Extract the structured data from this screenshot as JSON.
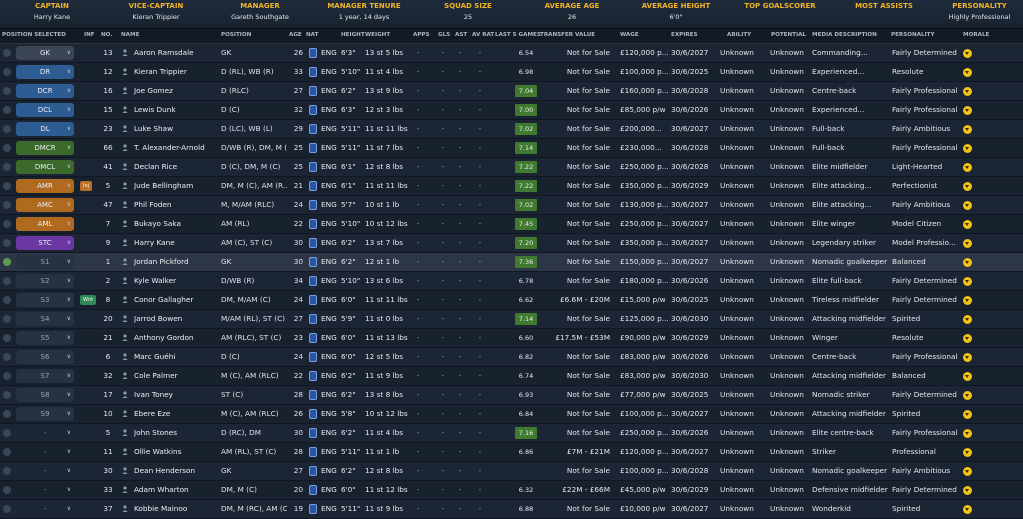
{
  "summary": [
    {
      "key": "captain",
      "label": "CAPTAIN",
      "value": "Harry Kane"
    },
    {
      "key": "vice_captain",
      "label": "VICE-CAPTAIN",
      "value": "Kieran Trippier"
    },
    {
      "key": "manager",
      "label": "MANAGER",
      "value": "Gareth Southgate"
    },
    {
      "key": "manager_tenure",
      "label": "MANAGER TENURE",
      "value": "1 year, 14 days"
    },
    {
      "key": "squad_size",
      "label": "SQUAD SIZE",
      "value": "25"
    },
    {
      "key": "average_age",
      "label": "AVERAGE AGE",
      "value": "26"
    },
    {
      "key": "average_height",
      "label": "AVERAGE HEIGHT",
      "value": "6'0\""
    },
    {
      "key": "top_goalscorer",
      "label": "TOP GOALSCORER",
      "value": ""
    },
    {
      "key": "most_assists",
      "label": "MOST ASSISTS",
      "value": ""
    },
    {
      "key": "personality",
      "label": "PERSONALITY",
      "value": "Highly Professional"
    }
  ],
  "columns": {
    "position_selected": "POSITION SELECTED",
    "inf": "INF",
    "no": "NO.",
    "name": "NAME",
    "position": "POSITION",
    "age": "AGE",
    "nat": "NAT",
    "height": "HEIGHT",
    "weight": "WEIGHT",
    "apps": "APPS",
    "gls": "GLS",
    "ast": "AST",
    "av_rat": "AV RAT",
    "last5": "LAST 5 GAMES",
    "transfer_value": "TRANSFER VALUE",
    "wage": "WAGE",
    "expires": "EXPIRES",
    "ability": "ABILITY",
    "potential": "POTENTIAL",
    "media": "MEDIA DESCRIPTION",
    "personality": "PERSONALITY",
    "morale": "MORALE"
  },
  "colors": {
    "header_accent": "#f0b429",
    "pos_def": "#2c5c92",
    "pos_mid": "#3c6a2a",
    "pos_amid": "#b06a1f",
    "pos_st": "#6a37a3",
    "morale": "#f3c316",
    "form_good": "#3f7a30"
  },
  "players": [
    {
      "sel": "GK",
      "cls": "p-gk",
      "inf": "",
      "no": "13",
      "name": "Aaron Ramsdale",
      "position": "GK",
      "age": "26",
      "nat": "ENG",
      "height": "6'3\"",
      "weight": "13 st 5 lbs",
      "apps": "-",
      "gls": "-",
      "ast": "-",
      "avr": "-",
      "rating": "6.54",
      "hi": false,
      "value": "Not for Sale",
      "wage": "£120,000 p...",
      "expires": "30/6/2027",
      "ability": "Unknown",
      "potential": "Unknown",
      "media": "Commanding...",
      "personality": "Fairly Determined"
    },
    {
      "sel": "DR",
      "cls": "p-def",
      "inf": "",
      "no": "12",
      "name": "Kieran Trippier",
      "position": "D (RL), WB (R)",
      "age": "33",
      "nat": "ENG",
      "height": "5'10\"",
      "weight": "11 st 4 lbs",
      "apps": "-",
      "gls": "-",
      "ast": "-",
      "avr": "-",
      "rating": "6.98",
      "hi": false,
      "value": "Not for Sale",
      "wage": "£100,000 p...",
      "expires": "30/6/2025",
      "ability": "Unknown",
      "potential": "Unknown",
      "media": "Experienced...",
      "personality": "Resolute"
    },
    {
      "sel": "DCR",
      "cls": "p-def",
      "inf": "",
      "no": "16",
      "name": "Joe Gomez",
      "position": "D (RLC)",
      "age": "27",
      "nat": "ENG",
      "height": "6'2\"",
      "weight": "13 st 9 lbs",
      "apps": "-",
      "gls": "-",
      "ast": "-",
      "avr": "-",
      "rating": "7.04",
      "hi": true,
      "value": "Not for Sale",
      "wage": "£160,000 p...",
      "expires": "30/6/2028",
      "ability": "Unknown",
      "potential": "Unknown",
      "media": "Centre-back",
      "personality": "Fairly Professional"
    },
    {
      "sel": "DCL",
      "cls": "p-def",
      "inf": "",
      "no": "15",
      "name": "Lewis Dunk",
      "position": "D (C)",
      "age": "32",
      "nat": "ENG",
      "height": "6'3\"",
      "weight": "12 st 3 lbs",
      "apps": "-",
      "gls": "-",
      "ast": "-",
      "avr": "-",
      "rating": "7.00",
      "hi": true,
      "value": "Not for Sale",
      "wage": "£85,000 p/w",
      "expires": "30/6/2026",
      "ability": "Unknown",
      "potential": "Unknown",
      "media": "Experienced...",
      "personality": "Fairly Professional"
    },
    {
      "sel": "DL",
      "cls": "p-def",
      "inf": "",
      "no": "23",
      "name": "Luke Shaw",
      "position": "D (LC), WB (L)",
      "age": "29",
      "nat": "ENG",
      "height": "5'11\"",
      "weight": "11 st 11 lbs",
      "apps": "-",
      "gls": "-",
      "ast": "-",
      "avr": "-",
      "rating": "7.02",
      "hi": true,
      "value": "Not for Sale",
      "wage": "£200,000...",
      "expires": "30/6/2027",
      "ability": "Unknown",
      "potential": "Unknown",
      "media": "Full-back",
      "personality": "Fairly Ambitious"
    },
    {
      "sel": "DMCR",
      "cls": "p-mid",
      "inf": "",
      "no": "66",
      "name": "T. Alexander-Arnold",
      "position": "D/WB (R), DM, M (...",
      "age": "25",
      "nat": "ENG",
      "height": "5'11\"",
      "weight": "11 st 7 lbs",
      "apps": "-",
      "gls": "-",
      "ast": "-",
      "avr": "-",
      "rating": "7.14",
      "hi": true,
      "value": "Not for Sale",
      "wage": "£230,000...",
      "expires": "30/6/2028",
      "ability": "Unknown",
      "potential": "Unknown",
      "media": "Full-back",
      "personality": "Fairly Professional"
    },
    {
      "sel": "DMCL",
      "cls": "p-mid",
      "inf": "",
      "no": "41",
      "name": "Declan Rice",
      "position": "D (C), DM, M (C)",
      "age": "25",
      "nat": "ENG",
      "height": "6'1\"",
      "weight": "12 st 8 lbs",
      "apps": "-",
      "gls": "-",
      "ast": "-",
      "avr": "-",
      "rating": "7.22",
      "hi": true,
      "value": "Not for Sale",
      "wage": "£250,000 p...",
      "expires": "30/6/2028",
      "ability": "Unknown",
      "potential": "Unknown",
      "media": "Elite midfielder",
      "personality": "Light-Hearted"
    },
    {
      "sel": "AMR",
      "cls": "p-amid",
      "inf": "Inj",
      "inftype": "orange",
      "no": "5",
      "name": "Jude Bellingham",
      "position": "DM, M (C), AM (R...",
      "age": "21",
      "nat": "ENG",
      "height": "6'1\"",
      "weight": "11 st 11 lbs",
      "apps": "-",
      "gls": "-",
      "ast": "-",
      "avr": "-",
      "rating": "7.22",
      "hi": true,
      "value": "Not for Sale",
      "wage": "£350,000 p...",
      "expires": "30/6/2029",
      "ability": "Unknown",
      "potential": "Unknown",
      "media": "Elite attacking...",
      "personality": "Perfectionist"
    },
    {
      "sel": "AMC",
      "cls": "p-amid",
      "inf": "",
      "no": "47",
      "name": "Phil Foden",
      "position": "M, M/AM (RLC)",
      "age": "24",
      "nat": "ENG",
      "height": "5'7\"",
      "weight": "10 st 1 lb",
      "apps": "-",
      "gls": "-",
      "ast": "-",
      "avr": "-",
      "rating": "7.02",
      "hi": true,
      "value": "Not for Sale",
      "wage": "£130,000 p...",
      "expires": "30/6/2027",
      "ability": "Unknown",
      "potential": "Unknown",
      "media": "Elite attacking...",
      "personality": "Fairly Ambitious"
    },
    {
      "sel": "AML",
      "cls": "p-amid",
      "inf": "",
      "no": "7",
      "name": "Bukayo Saka",
      "position": "AM (RL)",
      "age": "22",
      "nat": "ENG",
      "height": "5'10\"",
      "weight": "10 st 12 lbs",
      "apps": "-",
      "gls": "-",
      "ast": "-",
      "avr": "-",
      "rating": "7.45",
      "hi": true,
      "value": "Not for Sale",
      "wage": "£250,000 p...",
      "expires": "30/6/2027",
      "ability": "Unknown",
      "potential": "Unknown",
      "media": "Elite winger",
      "personality": "Model Citizen"
    },
    {
      "sel": "STC",
      "cls": "p-st",
      "inf": "",
      "no": "9",
      "name": "Harry Kane",
      "position": "AM (C), ST (C)",
      "age": "30",
      "nat": "ENG",
      "height": "6'2\"",
      "weight": "13 st 7 lbs",
      "apps": "-",
      "gls": "-",
      "ast": "-",
      "avr": "-",
      "rating": "7.20",
      "hi": true,
      "value": "Not for Sale",
      "wage": "£350,000 p...",
      "expires": "30/6/2027",
      "ability": "Unknown",
      "potential": "Unknown",
      "media": "Legendary striker",
      "personality": "Model Professio..."
    },
    {
      "sel": "S1",
      "cls": "p-sub",
      "inf": "",
      "no": "1",
      "name": "Jordan Pickford",
      "position": "GK",
      "age": "30",
      "nat": "ENG",
      "height": "6'2\"",
      "weight": "12 st 1 lb",
      "apps": "-",
      "gls": "-",
      "ast": "-",
      "avr": "-",
      "rating": "7.36",
      "hi": true,
      "value": "Not for Sale",
      "wage": "£150,000 p...",
      "expires": "30/6/2027",
      "ability": "Unknown",
      "potential": "Unknown",
      "media": "Nomadic goalkeeper",
      "personality": "Balanced",
      "highlight": true
    },
    {
      "sel": "S2",
      "cls": "p-sub",
      "inf": "",
      "no": "2",
      "name": "Kyle Walker",
      "position": "D/WB (R)",
      "age": "34",
      "nat": "ENG",
      "height": "5'10\"",
      "weight": "13 st 6 lbs",
      "apps": "-",
      "gls": "-",
      "ast": "-",
      "avr": "-",
      "rating": "6.78",
      "hi": false,
      "value": "Not for Sale",
      "wage": "£180,000 p...",
      "expires": "30/6/2026",
      "ability": "Unknown",
      "potential": "Unknown",
      "media": "Elite full-back",
      "personality": "Fairly Determined"
    },
    {
      "sel": "S3",
      "cls": "p-sub",
      "inf": "Wnt",
      "inftype": "green",
      "no": "8",
      "name": "Conor Gallagher",
      "position": "DM, M/AM (C)",
      "age": "24",
      "nat": "ENG",
      "height": "6'0\"",
      "weight": "11 st 11 lbs",
      "apps": "-",
      "gls": "-",
      "ast": "-",
      "avr": "-",
      "rating": "6.62",
      "hi": false,
      "value": "£6.6M - £20M",
      "wage": "£15,000 p/w",
      "expires": "30/6/2025",
      "ability": "Unknown",
      "potential": "Unknown",
      "media": "Tireless midfielder",
      "personality": "Fairly Determined"
    },
    {
      "sel": "S4",
      "cls": "p-sub",
      "inf": "",
      "no": "20",
      "name": "Jarrod Bowen",
      "position": "M/AM (RL), ST (C)",
      "age": "27",
      "nat": "ENG",
      "height": "5'9\"",
      "weight": "11 st 0 lbs",
      "apps": "-",
      "gls": "-",
      "ast": "-",
      "avr": "-",
      "rating": "7.14",
      "hi": true,
      "value": "Not for Sale",
      "wage": "£125,000 p...",
      "expires": "30/6/2030",
      "ability": "Unknown",
      "potential": "Unknown",
      "media": "Attacking midfielder",
      "personality": "Spirited"
    },
    {
      "sel": "S5",
      "cls": "p-sub",
      "inf": "",
      "no": "21",
      "name": "Anthony Gordon",
      "position": "AM (RLC), ST (C)",
      "age": "23",
      "nat": "ENG",
      "height": "6'0\"",
      "weight": "11 st 13 lbs",
      "apps": "-",
      "gls": "-",
      "ast": "-",
      "avr": "-",
      "rating": "6.60",
      "hi": false,
      "value": "£17.5M - £53M",
      "wage": "£90,000 p/w",
      "expires": "30/6/2029",
      "ability": "Unknown",
      "potential": "Unknown",
      "media": "Winger",
      "personality": "Resolute"
    },
    {
      "sel": "S6",
      "cls": "p-sub",
      "inf": "",
      "no": "6",
      "name": "Marc Guéhi",
      "position": "D (C)",
      "age": "24",
      "nat": "ENG",
      "height": "6'0\"",
      "weight": "12 st 5 lbs",
      "apps": "-",
      "gls": "-",
      "ast": "-",
      "avr": "-",
      "rating": "6.82",
      "hi": false,
      "value": "Not for Sale",
      "wage": "£83,000 p/w",
      "expires": "30/6/2026",
      "ability": "Unknown",
      "potential": "Unknown",
      "media": "Centre-back",
      "personality": "Fairly Professional"
    },
    {
      "sel": "S7",
      "cls": "p-sub",
      "inf": "",
      "no": "32",
      "name": "Cole Palmer",
      "position": "M (C), AM (RLC)",
      "age": "22",
      "nat": "ENG",
      "height": "6'2\"",
      "weight": "11 st 9 lbs",
      "apps": "-",
      "gls": "-",
      "ast": "-",
      "avr": "-",
      "rating": "6.74",
      "hi": false,
      "value": "Not for Sale",
      "wage": "£83,000 p/w",
      "expires": "30/6/2030",
      "ability": "Unknown",
      "potential": "Unknown",
      "media": "Attacking midfielder",
      "personality": "Balanced"
    },
    {
      "sel": "S8",
      "cls": "p-sub",
      "inf": "",
      "no": "17",
      "name": "Ivan Toney",
      "position": "ST (C)",
      "age": "28",
      "nat": "ENG",
      "height": "6'2\"",
      "weight": "13 st 8 lbs",
      "apps": "-",
      "gls": "-",
      "ast": "-",
      "avr": "-",
      "rating": "6.93",
      "hi": false,
      "value": "Not for Sale",
      "wage": "£77,000 p/w",
      "expires": "30/6/2025",
      "ability": "Unknown",
      "potential": "Unknown",
      "media": "Nomadic striker",
      "personality": "Fairly Determined"
    },
    {
      "sel": "S9",
      "cls": "p-sub",
      "inf": "",
      "no": "10",
      "name": "Ebere Eze",
      "position": "M (C), AM (RLC)",
      "age": "26",
      "nat": "ENG",
      "height": "5'8\"",
      "weight": "10 st 12 lbs",
      "apps": "-",
      "gls": "-",
      "ast": "-",
      "avr": "-",
      "rating": "6.84",
      "hi": false,
      "value": "Not for Sale",
      "wage": "£100,000 p...",
      "expires": "30/6/2027",
      "ability": "Unknown",
      "potential": "Unknown",
      "media": "Attacking midfielder",
      "personality": "Spirited"
    },
    {
      "sel": "-",
      "cls": "p-none",
      "inf": "",
      "no": "5",
      "name": "John Stones",
      "position": "D (RC), DM",
      "age": "30",
      "nat": "ENG",
      "height": "6'2\"",
      "weight": "11 st 4 lbs",
      "apps": "-",
      "gls": "-",
      "ast": "-",
      "avr": "-",
      "rating": "7.16",
      "hi": true,
      "value": "Not for Sale",
      "wage": "£250,000 p...",
      "expires": "30/6/2026",
      "ability": "Unknown",
      "potential": "Unknown",
      "media": "Elite centre-back",
      "personality": "Fairly Professional"
    },
    {
      "sel": "-",
      "cls": "p-none",
      "inf": "",
      "no": "11",
      "name": "Ollie Watkins",
      "position": "AM (RL), ST (C)",
      "age": "28",
      "nat": "ENG",
      "height": "5'11\"",
      "weight": "11 st 1 lb",
      "apps": "-",
      "gls": "-",
      "ast": "-",
      "avr": "-",
      "rating": "6.86",
      "hi": false,
      "value": "£7M - £21M",
      "wage": "£120,000 p...",
      "expires": "30/6/2027",
      "ability": "Unknown",
      "potential": "Unknown",
      "media": "Striker",
      "personality": "Professional"
    },
    {
      "sel": "-",
      "cls": "p-none",
      "inf": "",
      "no": "30",
      "name": "Dean Henderson",
      "position": "GK",
      "age": "27",
      "nat": "ENG",
      "height": "6'2\"",
      "weight": "12 st 8 lbs",
      "apps": "-",
      "gls": "-",
      "ast": "-",
      "avr": "-",
      "rating": "",
      "hi": false,
      "value": "Not for Sale",
      "wage": "£100,000 p...",
      "expires": "30/6/2028",
      "ability": "Unknown",
      "potential": "Unknown",
      "media": "Nomadic goalkeeper",
      "personality": "Fairly Ambitious"
    },
    {
      "sel": "-",
      "cls": "p-none",
      "inf": "",
      "no": "33",
      "name": "Adam Wharton",
      "position": "DM, M (C)",
      "age": "20",
      "nat": "ENG",
      "height": "6'0\"",
      "weight": "11 st 12 lbs",
      "apps": "-",
      "gls": "-",
      "ast": "-",
      "avr": "-",
      "rating": "6.32",
      "hi": false,
      "value": "£22M - £66M",
      "wage": "£45,000 p/w",
      "expires": "30/6/2029",
      "ability": "Unknown",
      "potential": "Unknown",
      "media": "Defensive midfielder",
      "personality": "Fairly Determined"
    },
    {
      "sel": "-",
      "cls": "p-none",
      "inf": "",
      "no": "37",
      "name": "Kobbie Mainoo",
      "position": "DM, M (RC), AM (C)",
      "age": "19",
      "nat": "ENG",
      "height": "5'11\"",
      "weight": "11 st 9 lbs",
      "apps": "-",
      "gls": "-",
      "ast": "-",
      "avr": "-",
      "rating": "6.88",
      "hi": false,
      "value": "Not for Sale",
      "wage": "£10,000 p/w",
      "expires": "30/6/2027",
      "ability": "Unknown",
      "potential": "Unknown",
      "media": "Wonderkid",
      "personality": "Spirited"
    }
  ]
}
